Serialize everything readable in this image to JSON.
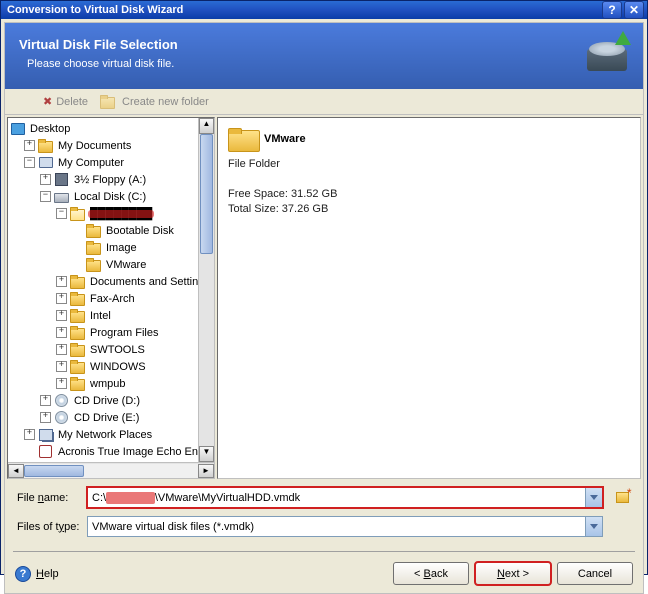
{
  "titlebar": {
    "text": "Conversion to Virtual Disk Wizard"
  },
  "header": {
    "title": "Virtual Disk File Selection",
    "subtitle": "Please choose virtual disk file."
  },
  "toolbar": {
    "delete": "Delete",
    "create_folder": "Create new folder"
  },
  "tree": {
    "desktop": "Desktop",
    "my_documents": "My Documents",
    "my_computer": "My Computer",
    "floppy": "3½ Floppy (A:)",
    "local_disk": "Local Disk (C:)",
    "redacted_folder": "████████",
    "bootable_disk": "Bootable Disk",
    "image": "Image",
    "vmware": "VMware",
    "documents_settings": "Documents and Setting",
    "fax_arch": "Fax-Arch",
    "intel": "Intel",
    "program_files": "Program Files",
    "swtools": "SWTOOLS",
    "windows": "WINDOWS",
    "wmpub": "wmpub",
    "cd_d": "CD Drive (D:)",
    "cd_e": "CD Drive (E:)",
    "network_places": "My Network Places",
    "acronis": "Acronis True Image Echo Ente"
  },
  "details": {
    "name": "VMware",
    "type": "File Folder",
    "free_space": "Free Space: 31.52 GB",
    "total_size": "Total Size: 37.26 GB"
  },
  "form": {
    "filename_label": "File name:",
    "filename_prefix": "C:\\",
    "filename_redacted": "██████",
    "filename_suffix": "\\VMware\\MyVirtualHDD.vmdk",
    "filetype_label": "Files of type:",
    "filetype_value": "VMware virtual disk files (*.vmdk)"
  },
  "footer": {
    "help": "Help",
    "back": "< Back",
    "next": "Next >",
    "cancel": "Cancel"
  }
}
